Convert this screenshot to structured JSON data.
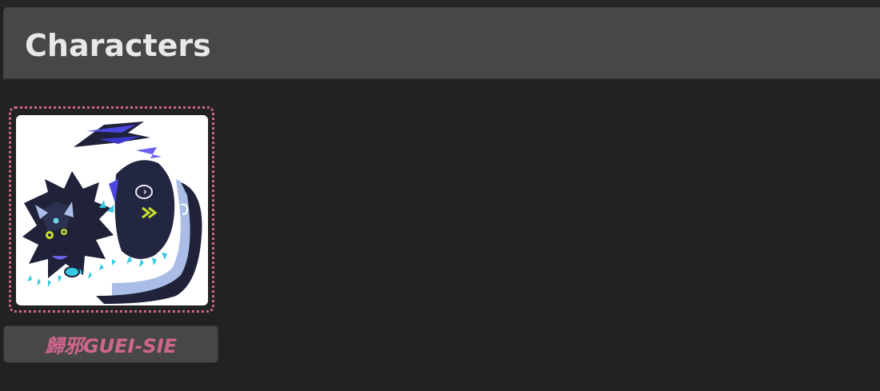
{
  "page": {
    "title": "Characters"
  },
  "characters": [
    {
      "name": "歸邪GUEI-SIE",
      "accent_color": "#d0668d",
      "thumbnail_icon": "character-art-thumbnail"
    }
  ],
  "colors": {
    "background": "#222222",
    "header": "#474747",
    "title_text": "#e8e8e8",
    "accent": "#d0668d"
  }
}
